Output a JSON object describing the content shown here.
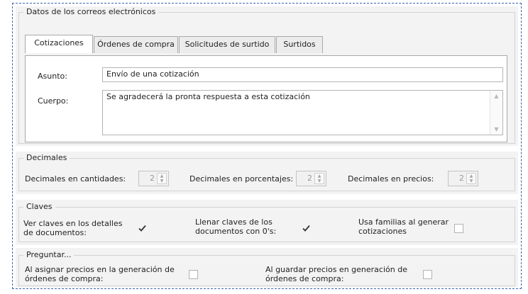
{
  "email_group": {
    "title": "Datos de los correos electrónicos",
    "tabs": [
      "Cotizaciones",
      "Órdenes de compra",
      "Solicitudes de surtido",
      "Surtidos"
    ],
    "active_tab": "Cotizaciones",
    "subject_label": "Asunto:",
    "subject_value": "Envío de una cotización",
    "body_label": "Cuerpo:",
    "body_value": "Se agradecerá la pronta respuesta a esta cotización"
  },
  "decimals_group": {
    "title": "Decimales",
    "quantities_label": "Decimales en cantidades:",
    "quantities_value": "2",
    "percentages_label": "Decimales en porcentajes:",
    "percentages_value": "2",
    "prices_label": "Decimales en precios:",
    "prices_value": "2"
  },
  "keys_group": {
    "title": "Claves",
    "show_keys_label_1": "Ver claves en los detalles",
    "show_keys_label_2": "de documentos:",
    "show_keys_checked": true,
    "fill_keys_label_1": "Llenar claves de los",
    "fill_keys_label_2": "documentos con 0's:",
    "fill_keys_checked": true,
    "families_label_1": "Usa familias al generar",
    "families_label_2": "cotizaciones",
    "families_checked": false
  },
  "ask_group": {
    "title": "Preguntar...",
    "assign_prices_label_1": "Al asignar precios en la generación de",
    "assign_prices_label_2": "órdenes de compra:",
    "assign_prices_checked": false,
    "save_prices_label_1": "Al guardar precios en generación de",
    "save_prices_label_2": "órdenes de compra:",
    "save_prices_checked": false
  }
}
